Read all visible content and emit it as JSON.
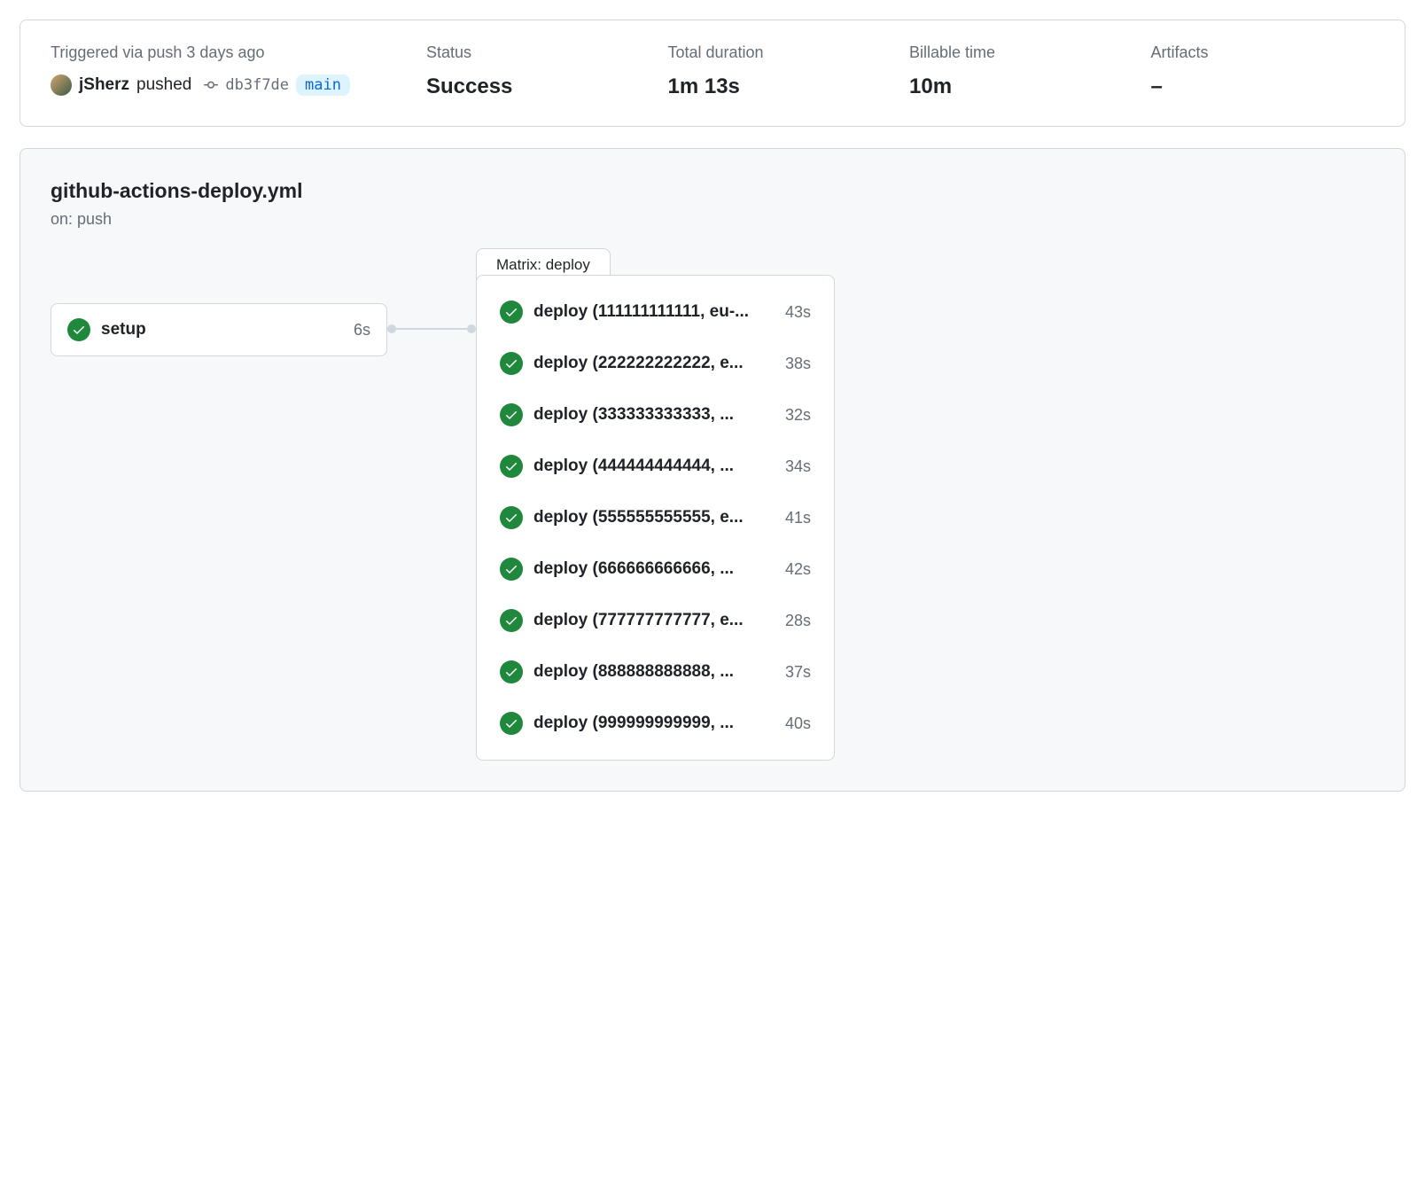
{
  "summary": {
    "trigger_label": "Triggered via push 3 days ago",
    "username": "jSherz",
    "action_text": "pushed",
    "commit_sha": "db3f7de",
    "branch": "main",
    "status_label": "Status",
    "status_value": "Success",
    "duration_label": "Total duration",
    "duration_value": "1m 13s",
    "billable_label": "Billable time",
    "billable_value": "10m",
    "artifacts_label": "Artifacts",
    "artifacts_value": "–"
  },
  "workflow": {
    "filename": "github-actions-deploy.yml",
    "trigger": "on: push"
  },
  "setup_job": {
    "name": "setup",
    "duration": "6s"
  },
  "matrix": {
    "label": "Matrix: deploy",
    "jobs": [
      {
        "name": "deploy (111111111111, eu-...",
        "duration": "43s"
      },
      {
        "name": "deploy (222222222222, e...",
        "duration": "38s"
      },
      {
        "name": "deploy (333333333333, ...",
        "duration": "32s"
      },
      {
        "name": "deploy (444444444444, ...",
        "duration": "34s"
      },
      {
        "name": "deploy (555555555555, e...",
        "duration": "41s"
      },
      {
        "name": "deploy (666666666666, ...",
        "duration": "42s"
      },
      {
        "name": "deploy (777777777777, e...",
        "duration": "28s"
      },
      {
        "name": "deploy (888888888888, ...",
        "duration": "37s"
      },
      {
        "name": "deploy (999999999999, ...",
        "duration": "40s"
      }
    ]
  }
}
